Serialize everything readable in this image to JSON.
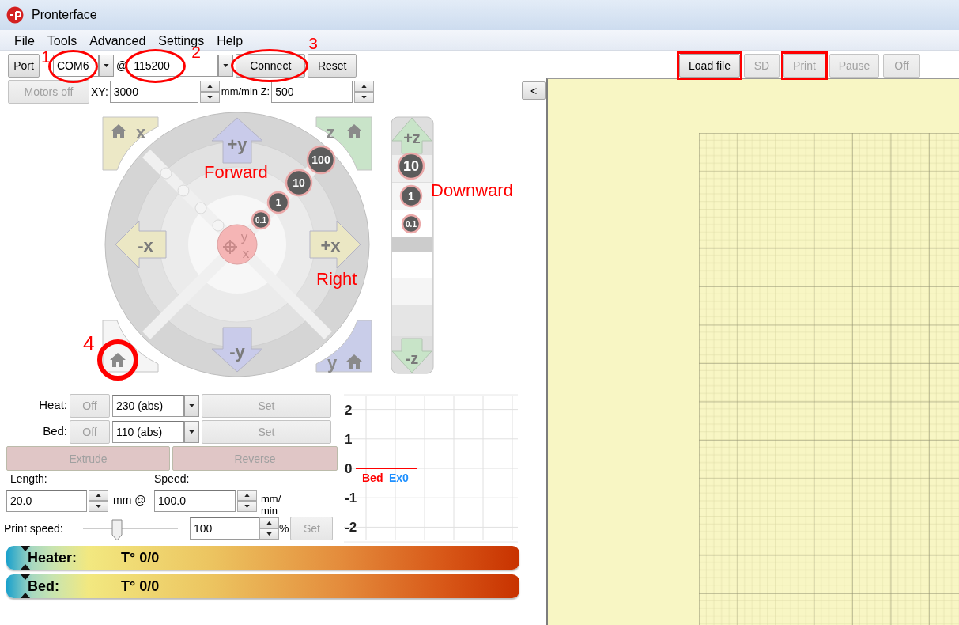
{
  "window": {
    "title": "Pronterface"
  },
  "menu": [
    "File",
    "Tools",
    "Advanced",
    "Settings",
    "Help"
  ],
  "connection": {
    "port_button": "Port",
    "port": {
      "value": "COM6",
      "circled": true,
      "callout": "1"
    },
    "at_sign": "@",
    "baud": {
      "value": "115200",
      "circled": true,
      "callout": "2"
    },
    "connect": {
      "label": "Connect",
      "circled": true,
      "callout": "3"
    },
    "reset": "Reset"
  },
  "motion": {
    "motors_off": {
      "label": "Motors off",
      "disabled": true
    },
    "xy_label": "XY:",
    "xy_feed": "3000",
    "z_label": "mm/min Z:",
    "z_feed": "500"
  },
  "jog": {
    "home": [
      {
        "label": "x"
      },
      {
        "label": "z"
      },
      {
        "circled": true,
        "callout": "4"
      },
      {
        "label": "y"
      }
    ],
    "xy_moves": [
      "+y",
      "-x",
      "+x",
      "-y"
    ],
    "xy_steps": [
      "0.1",
      "1",
      "10",
      "100"
    ],
    "center": [
      "y",
      "x"
    ],
    "z_moves": [
      "+z",
      "-z"
    ],
    "z_steps": [
      "10",
      "1",
      "0.1"
    ],
    "annotations": [
      "Forward",
      "Right",
      "Downward"
    ]
  },
  "temperature": {
    "rows": [
      {
        "label": "Heat:",
        "off": {
          "label": "Off",
          "disabled": true
        },
        "value": "230 (abs)",
        "set": {
          "label": "Set",
          "disabled": true
        }
      },
      {
        "label": "Bed:",
        "off": {
          "label": "Off",
          "disabled": true
        },
        "value": "110 (abs)",
        "set": {
          "label": "Set",
          "disabled": true
        }
      }
    ],
    "extrude": {
      "label": "Extrude",
      "disabled": true
    },
    "reverse": {
      "label": "Reverse",
      "disabled": true
    },
    "length_label": "Length:",
    "length": "20.0",
    "length_unit": "mm @",
    "speed_label": "Speed:",
    "speed": "100.0",
    "speed_unit": "mm/min",
    "print_speed_label": "Print speed:",
    "print_speed": {
      "level": 0.36
    },
    "print_speed_value": "100",
    "percent": "%",
    "print_speed_set": {
      "label": "Set",
      "disabled": true
    }
  },
  "gauges": [
    {
      "label": "Heater:",
      "reading": "T° 0/0",
      "level": 0
    },
    {
      "label": "Bed:",
      "reading": "T° 0/0",
      "level": 0
    }
  ],
  "graph": {
    "chart_data": {
      "type": "line",
      "categories": [
        null,
        null,
        null,
        null,
        null,
        null,
        null,
        null
      ],
      "grid": true,
      "ylim": [
        -2.5,
        2.5
      ],
      "yticks": [
        {
          "value": -2,
          "label": "-2"
        },
        {
          "value": -1,
          "label": "-1"
        },
        {
          "value": 0,
          "label": "0"
        },
        {
          "value": 1,
          "label": "1"
        },
        {
          "value": 2,
          "label": "2"
        }
      ],
      "series": [
        {
          "name": "Bed",
          "color": "#ff0000",
          "values": [
            0,
            0,
            0,
            0,
            null,
            null,
            null,
            null
          ]
        },
        {
          "name": "Ex0",
          "color": "#1e90ff",
          "values": [
            null,
            null,
            null,
            null,
            null,
            null,
            null,
            null
          ]
        }
      ]
    }
  },
  "print_controls": {
    "buttons": [
      {
        "label": "Load file",
        "disabled": false,
        "boxed": true
      },
      {
        "label": "SD",
        "disabled": true
      },
      {
        "label": "Print",
        "disabled": true,
        "boxed": true
      },
      {
        "label": "Pause",
        "disabled": true
      },
      {
        "label": "Off",
        "disabled": true
      }
    ],
    "collapse": "<"
  }
}
